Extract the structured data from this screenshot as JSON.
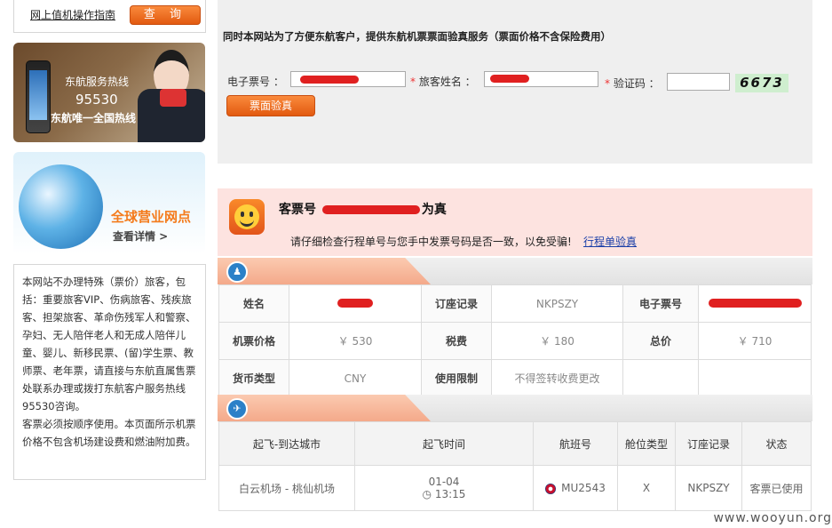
{
  "sidebar": {
    "guide_link": "网上值机操作指南",
    "guide_button": "查 询",
    "hotline_banner": {
      "title": "东航服务热线",
      "number": "95530",
      "subtitle": "东航唯一全国热线"
    },
    "global_banner": {
      "title": "全球营业网点",
      "more": "查看详情 >"
    },
    "notice_text": "本网站不办理特殊（票价）旅客，包括：重要旅客VIP、伤病旅客、残疾旅客、担架旅客、革命伤残军人和警察、孕妇、无人陪伴老人和无成人陪伴儿童、婴儿、新移民票、(留)学生票、教师票、老年票，请直接与东航直属售票处联系办理或拨打东航客户服务热线95530咨询。",
    "notice_text2": "客票必须按顺序使用。本页面所示机票价格不包含机场建设费和燃油附加费。"
  },
  "form": {
    "intro": "同时本网站为了方便东航客户，提供东航机票票面验真服务（票面价格不含保险费用）",
    "eticket_label": "电子票号 ：",
    "name_label": "旅客姓名 ：",
    "captcha_label": "验证码 ：",
    "captcha_value": "6673",
    "verify_button": "票面验真"
  },
  "result": {
    "title_prefix": "客票号",
    "title_suffix": "为真",
    "hint": "请仔细检查行程单号与您手中发票号码是否一致，以免受骗!",
    "link": "行程单验真"
  },
  "passenger": {
    "name_label": "姓名",
    "booking_label": "订座记录",
    "booking_value": "NKPSZY",
    "eticket_label": "电子票号",
    "fare_label": "机票价格",
    "fare_value": "￥ 530",
    "tax_label": "税费",
    "tax_value": "￥ 180",
    "total_label": "总价",
    "total_value": "￥ 710",
    "currency_label": "货币类型",
    "currency_value": "CNY",
    "restriction_label": "使用限制",
    "restriction_value": "不得签转收费更改"
  },
  "flight": {
    "headers": [
      "起飞-到达城市",
      "起飞时间",
      "航班号",
      "舱位类型",
      "订座记录",
      "状态"
    ],
    "row": {
      "route": "白云机场 - 桃仙机场",
      "date": "01-04",
      "time": "13:15",
      "flight_no": "MU2543",
      "cabin": "X",
      "booking": "NKPSZY",
      "status": "客票已使用"
    }
  },
  "watermark": "www.wooyun.org"
}
